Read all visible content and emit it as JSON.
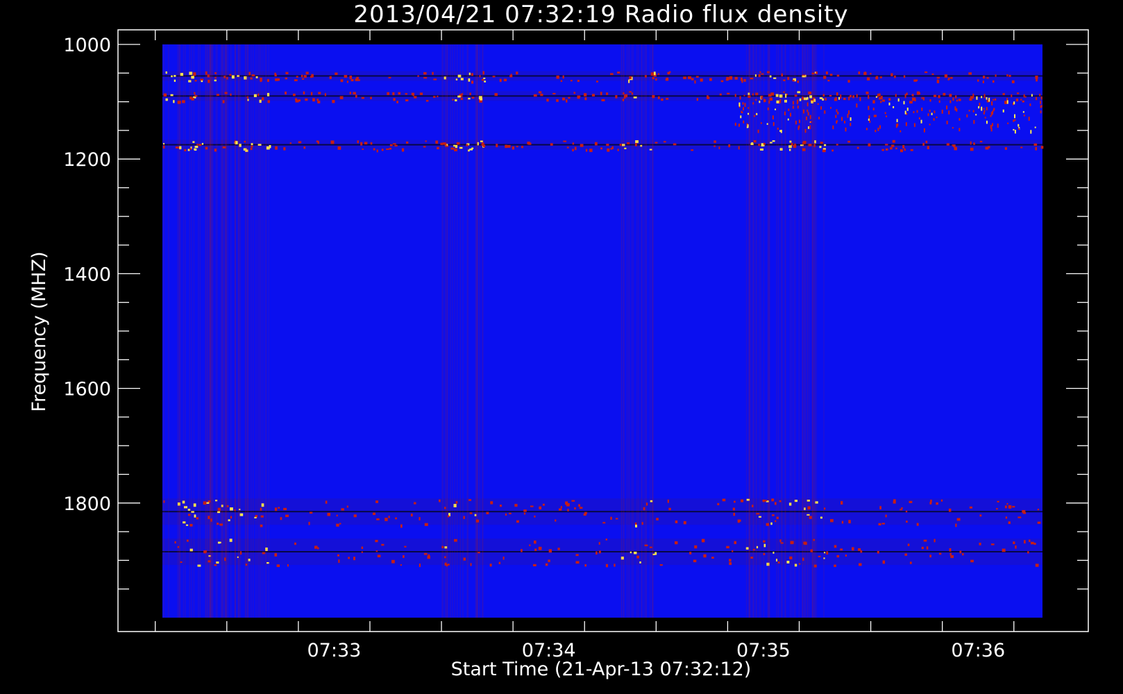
{
  "chart_data": {
    "type": "heatmap",
    "title": "2013/04/21 07:32:19 Radio flux density",
    "xlabel": "Start Time (21-Apr-13 07:32:12)",
    "ylabel": "Frequency (MHZ)",
    "x_ticks": [
      "07:33",
      "07:34",
      "07:35",
      "07:36"
    ],
    "y_ticks": [
      "1000",
      "1200",
      "1400",
      "1600",
      "1800"
    ],
    "xlim": [
      "07:32:12",
      "07:36:18"
    ],
    "ylim": [
      1000,
      2000
    ],
    "y_inverted": true,
    "colors": {
      "background": "#0a0ff0",
      "low": "#1414ff",
      "mid": "#c81e14",
      "high": "#ffea50",
      "frame": "#ffffff"
    },
    "features": {
      "emission_bands_mhz": [
        1055,
        1090,
        1175,
        1815,
        1885
      ],
      "burst_times": [
        "07:32:20–07:32:42",
        "07:33:30",
        "07:33:37",
        "07:34:20–07:34:30",
        "07:34:55–07:35:15"
      ]
    }
  }
}
